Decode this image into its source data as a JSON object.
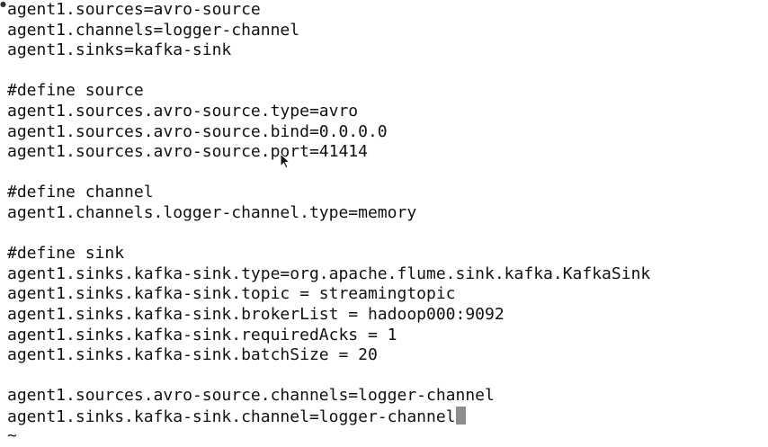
{
  "editor": {
    "lines": [
      "agent1.sources=avro-source",
      "agent1.channels=logger-channel",
      "agent1.sinks=kafka-sink",
      "",
      "#define source",
      "agent1.sources.avro-source.type=avro",
      "agent1.sources.avro-source.bind=0.0.0.0",
      "agent1.sources.avro-source.port=41414",
      "",
      "#define channel",
      "agent1.channels.logger-channel.type=memory",
      "",
      "#define sink",
      "agent1.sinks.kafka-sink.type=org.apache.flume.sink.kafka.KafkaSink",
      "agent1.sinks.kafka-sink.topic = streamingtopic",
      "agent1.sinks.kafka-sink.brokerList = hadoop000:9092",
      "agent1.sinks.kafka-sink.requiredAcks = 1",
      "agent1.sinks.kafka-sink.batchSize = 20",
      "",
      "agent1.sources.avro-source.channels=logger-channel",
      "agent1.sinks.kafka-sink.channel=logger-channel"
    ],
    "empty_line_marker": "~"
  },
  "icons": {
    "cursor": "text-block-cursor",
    "pointer": "mouse-pointer-icon"
  },
  "colors": {
    "background": "#ffffff",
    "text": "#111111",
    "cursor": "#8e8e8e"
  }
}
